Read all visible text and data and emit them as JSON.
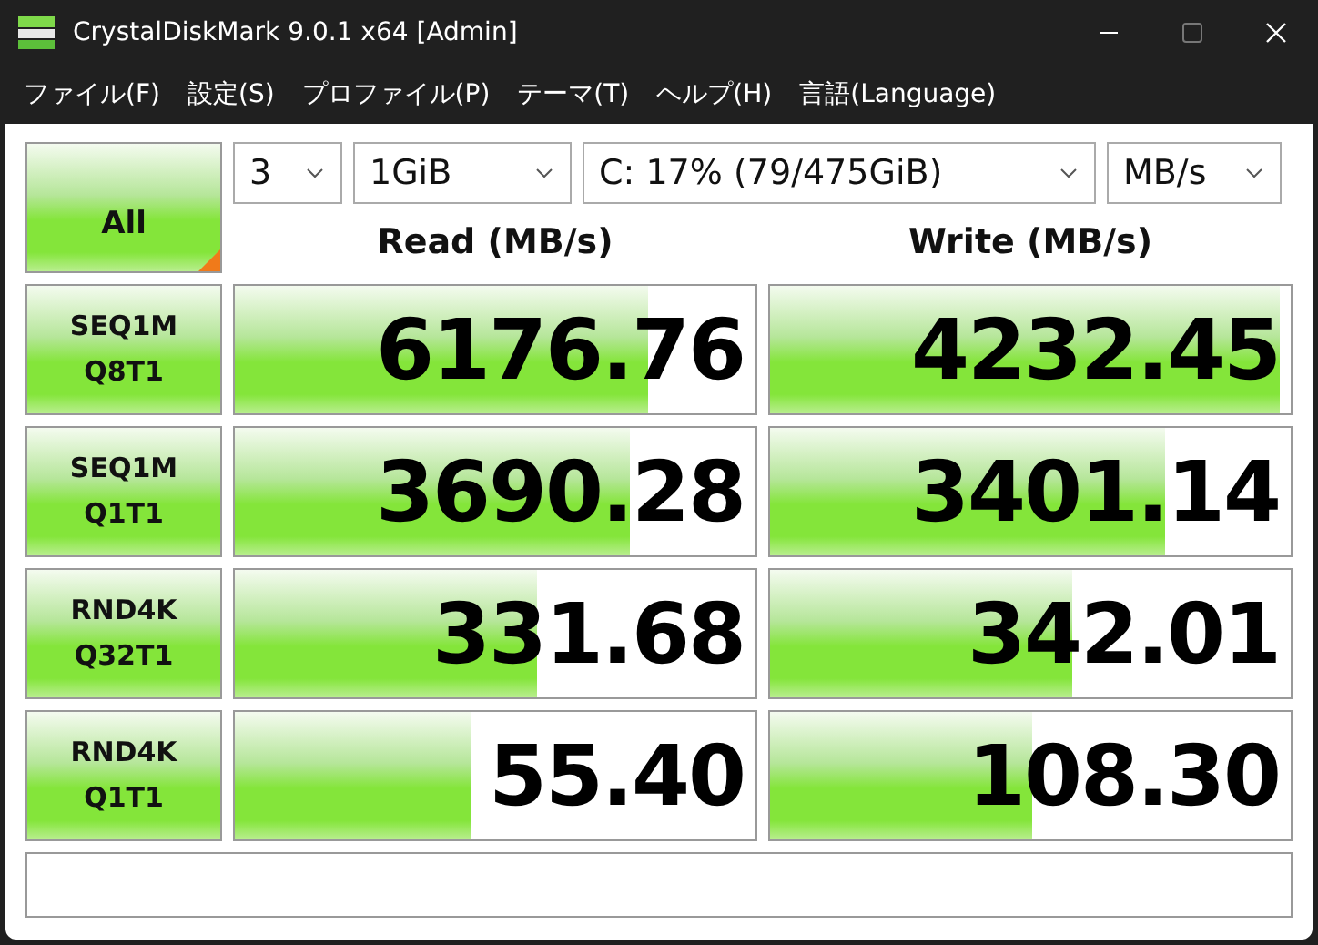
{
  "window": {
    "title": "CrystalDiskMark 9.0.1 x64 [Admin]"
  },
  "menu": [
    "ファイル(F)",
    "設定(S)",
    "プロファイル(P)",
    "テーマ(T)",
    "ヘルプ(H)",
    "言語(Language)"
  ],
  "all_button": {
    "label": "All"
  },
  "selectors": [
    {
      "kind": "count",
      "value": "3"
    },
    {
      "kind": "size",
      "value": "1GiB"
    },
    {
      "kind": "drive",
      "value": "C: 17% (79/475GiB)"
    },
    {
      "kind": "unit",
      "value": "MB/s"
    }
  ],
  "columns": [
    "Read (MB/s)",
    "Write (MB/s)"
  ],
  "tests": [
    {
      "label": [
        "SEQ1M",
        "Q8T1"
      ],
      "read": {
        "value": "6176.76",
        "level": 0.795
      },
      "write": {
        "value": "4232.45",
        "level": 0.98
      }
    },
    {
      "label": [
        "SEQ1M",
        "Q1T1"
      ],
      "read": {
        "value": "3690.28",
        "level": 0.76
      },
      "write": {
        "value": "3401.14",
        "level": 0.76
      }
    },
    {
      "label": [
        "RND4K",
        "Q32T1"
      ],
      "read": {
        "value": "331.68",
        "level": 0.58
      },
      "write": {
        "value": "342.01",
        "level": 0.58
      }
    },
    {
      "label": [
        "RND4K",
        "Q1T1"
      ],
      "read": {
        "value": "55.40",
        "level": 0.455
      },
      "write": {
        "value": "108.30",
        "level": 0.505
      }
    }
  ]
}
